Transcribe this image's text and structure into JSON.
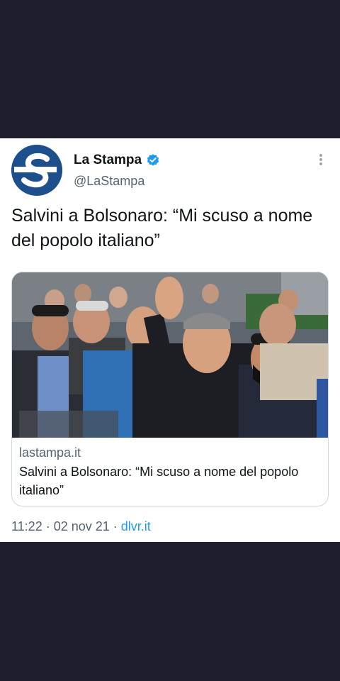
{
  "tweet": {
    "display_name": "La Stampa",
    "handle": "@LaStampa",
    "text": "Salvini a Bolsonaro: “Mi scuso a nome del popolo italiano”",
    "avatar_icon": "la-stampa-logo",
    "verified_icon": "verified-badge-icon",
    "more_icon": "more-options-icon",
    "timestamp": "11:22 · 02 nov 21 · ",
    "source": "dlvr.it"
  },
  "card": {
    "domain": "lastampa.it",
    "title": "Salvini a Bolsonaro: “Mi scuso a nome del popolo italiano”",
    "image_description_icon": "news-photo"
  },
  "colors": {
    "background": "#1e1e2e",
    "card_bg": "#ffffff",
    "brand_blue": "#1d4f8c",
    "verified_blue": "#1d9bf0",
    "text_primary": "#0f1419",
    "text_secondary": "#536471"
  }
}
